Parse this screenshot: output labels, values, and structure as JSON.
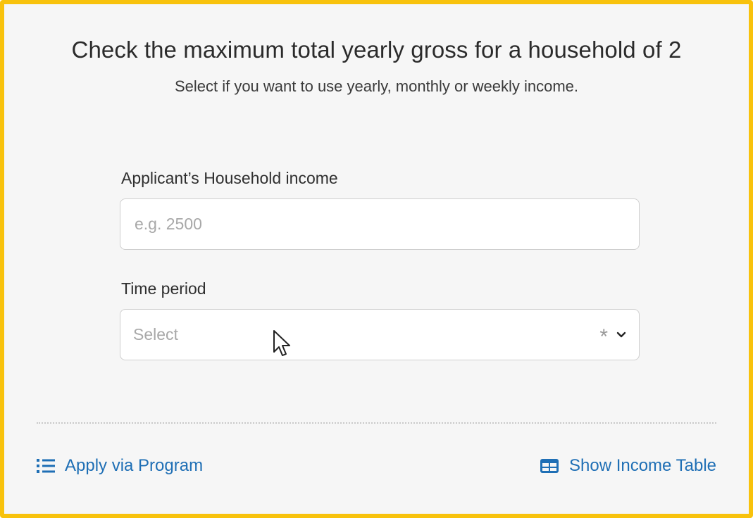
{
  "header": {
    "title": "Check the maximum total yearly gross for a household of 2",
    "subtitle": "Select if you want to use yearly, monthly or weekly income."
  },
  "form": {
    "income": {
      "label": "Applicant’s Household income",
      "placeholder": "e.g. 2500",
      "value": ""
    },
    "period": {
      "label": "Time period",
      "placeholder": "Select",
      "required_mark": "*",
      "icon": "chevron-down-icon"
    }
  },
  "footer": {
    "apply_label": "Apply via Program",
    "apply_icon": "list-icon",
    "table_label": "Show Income Table",
    "table_icon": "table-icon"
  },
  "colors": {
    "border_accent": "#f8c20c",
    "link": "#1f6fb5",
    "background": "#f6f6f6"
  }
}
